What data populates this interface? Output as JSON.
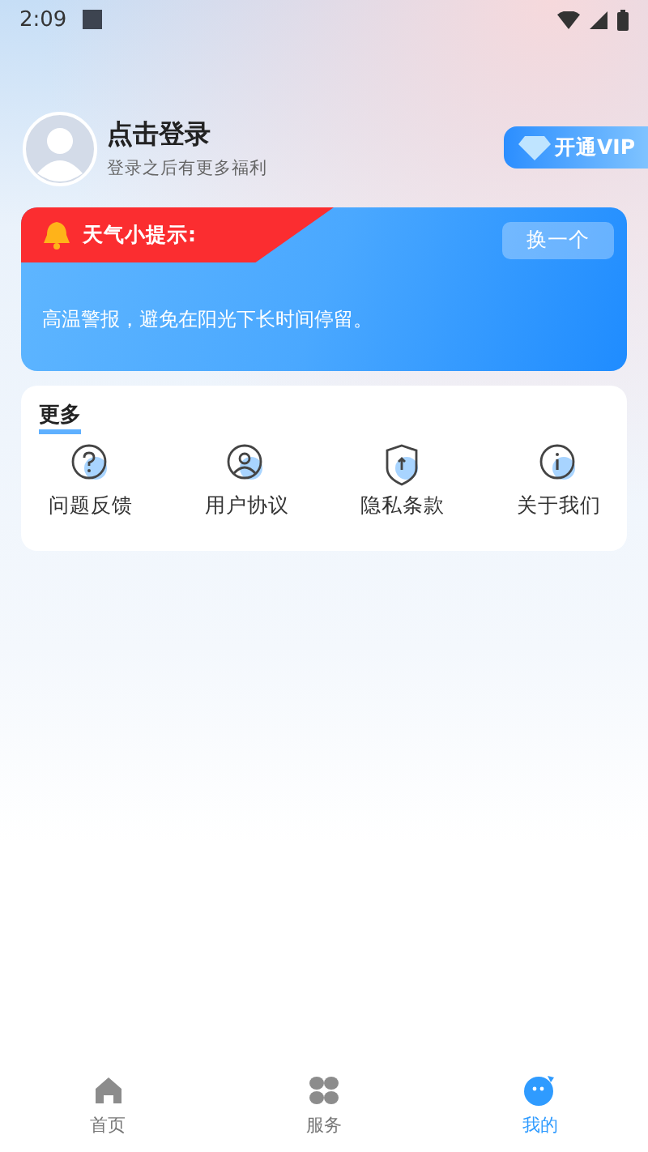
{
  "status_bar": {
    "time": "2:09"
  },
  "profile": {
    "title": "点击登录",
    "subtitle": "登录之后有更多福利",
    "vip_button": "开通VIP"
  },
  "weather": {
    "title": "天气小提示:",
    "button": "换一个",
    "message": "高温警报，避免在阳光下长时间停留。"
  },
  "more": {
    "title": "更多",
    "items": [
      {
        "kind": "question",
        "label": "问题反馈"
      },
      {
        "kind": "user",
        "label": "用户协议"
      },
      {
        "kind": "shield",
        "label": "隐私条款"
      },
      {
        "kind": "info",
        "label": "关于我们"
      }
    ]
  },
  "tabs": [
    {
      "kind": "home",
      "label": "首页",
      "selected": false
    },
    {
      "kind": "grid",
      "label": "服务",
      "selected": false
    },
    {
      "kind": "mine",
      "label": "我的",
      "selected": true
    }
  ]
}
